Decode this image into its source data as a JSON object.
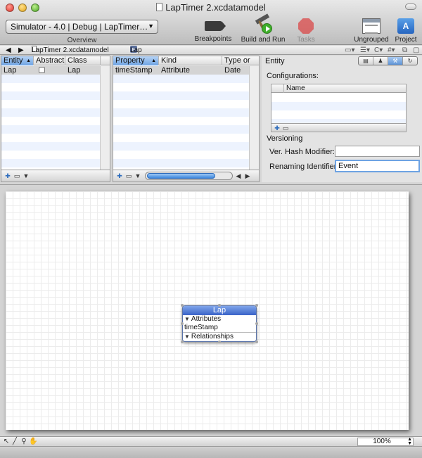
{
  "window": {
    "title": "LapTimer 2.xcdatamodel"
  },
  "toolbar": {
    "scheme": "Simulator - 4.0 | Debug | LapTimer…",
    "overview_label": "Overview",
    "breakpoints_label": "Breakpoints",
    "build_run_label": "Build and Run",
    "tasks_label": "Tasks",
    "ungrouped_label": "Ungrouped",
    "project_label": "Project"
  },
  "pathbar": {
    "file": "LapTimer 2.xcdatamodel",
    "entity": "Lap"
  },
  "entity_table": {
    "columns": [
      "Entity",
      "Abstract",
      "Class"
    ],
    "rows": [
      {
        "entity": "Lap",
        "abstract": false,
        "class": "Lap"
      }
    ]
  },
  "property_table": {
    "columns": [
      "Property",
      "Kind",
      "Type or"
    ],
    "rows": [
      {
        "property": "timeStamp",
        "kind": "Attribute",
        "type": "Date"
      }
    ]
  },
  "inspector": {
    "heading": "Entity",
    "configurations_label": "Configurations:",
    "config_column": "Name",
    "versioning_label": "Versioning",
    "hash_modifier_label": "Ver. Hash Modifier:",
    "hash_modifier_value": "",
    "renaming_label": "Renaming Identifier:",
    "renaming_value": "Event"
  },
  "diagram": {
    "entity_name": "Lap",
    "attributes_label": "Attributes",
    "attribute": "timeStamp",
    "relationships_label": "Relationships"
  },
  "bottom": {
    "zoom": "100%"
  },
  "colors": {
    "selection_blue": "#6ea3e3",
    "entity_header": "#3a63c8",
    "row_stripe": "#edf3fe"
  }
}
